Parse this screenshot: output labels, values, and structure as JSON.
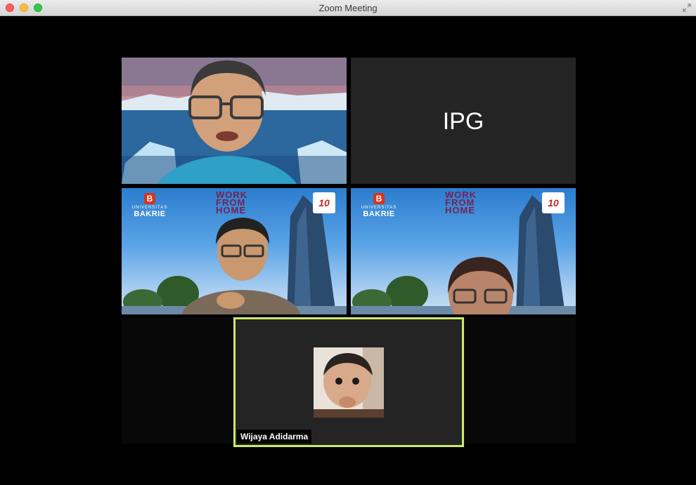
{
  "window": {
    "title": "Zoom Meeting"
  },
  "tiles": [
    {
      "kind": "video"
    },
    {
      "kind": "name",
      "label": "IPG"
    },
    {
      "kind": "video",
      "logo_small": "UNIVERSITAS",
      "logo_big": "BAKRIE",
      "logo_badge": "B",
      "wfh": [
        "WORK",
        "FROM",
        "HOME"
      ],
      "anniversary": "10"
    },
    {
      "kind": "video",
      "logo_small": "UNIVERSITAS",
      "logo_big": "BAKRIE",
      "logo_badge": "B",
      "wfh": [
        "WORK",
        "FROM",
        "HOME"
      ],
      "anniversary": "10"
    }
  ],
  "active_speaker": {
    "name": "Wijaya Adidarma",
    "border_color": "#cde96a"
  }
}
